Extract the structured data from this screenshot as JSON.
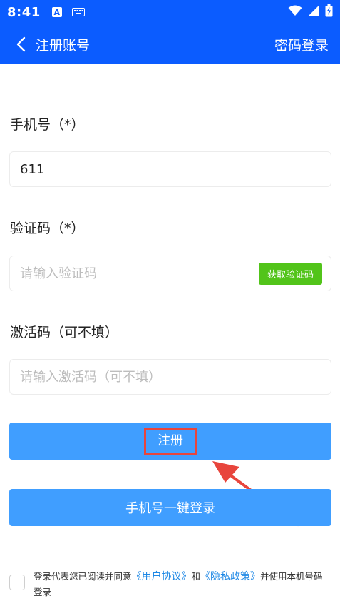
{
  "status_bar": {
    "time": "8:41",
    "badge": "A"
  },
  "header": {
    "title": "注册账号",
    "right_link": "密码登录"
  },
  "form": {
    "phone": {
      "label": "手机号（*）",
      "value": "611"
    },
    "code": {
      "label": "验证码（*）",
      "placeholder": "请输入验证码",
      "get_code_label": "获取验证码"
    },
    "activation": {
      "label": "激活码（可不填）",
      "placeholder": "请输入激活码（可不填）"
    }
  },
  "buttons": {
    "register": "注册",
    "one_click_login": "手机号一键登录"
  },
  "agreement": {
    "text_prefix": "登录代表您已阅读并同意",
    "user_agreement": "《用户协议》",
    "and": "和",
    "privacy_policy": "《隐私政策》",
    "text_suffix": "并使用本机号码登录"
  },
  "colors": {
    "header_bg": "#0b5cff",
    "button_bg": "#409eff",
    "get_code_bg": "#52c41a",
    "highlight_red": "#e8453c",
    "link_blue": "#1e88e5"
  }
}
